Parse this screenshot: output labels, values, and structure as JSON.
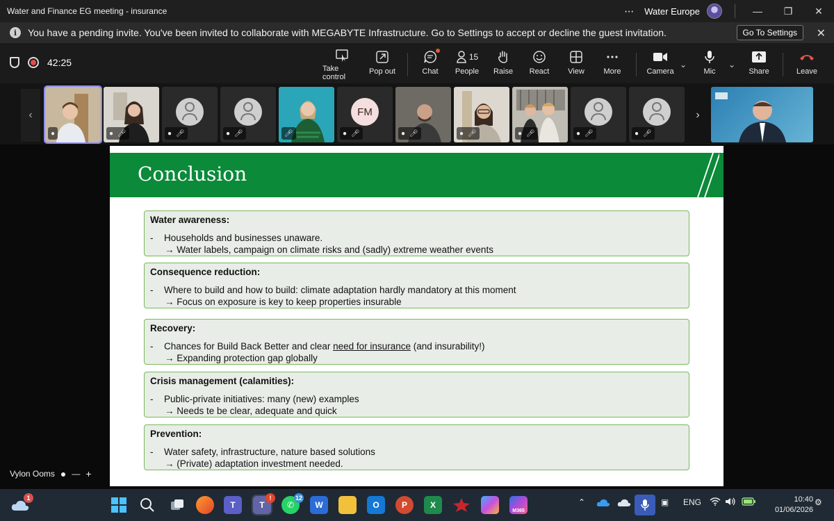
{
  "window": {
    "title": "Water and Finance EG meeting - insurance",
    "more_label": "⋯",
    "org_name": "Water Europe",
    "minimize": "—",
    "restore": "❐",
    "close": "✕"
  },
  "banner": {
    "message": "You have a pending invite. You've been invited to collaborate with MEGABYTE Infrastructure. Go to Settings to accept or decline the guest invitation.",
    "button": "Go To Settings",
    "close": "✕"
  },
  "meeting": {
    "timer": "42:25",
    "controls": {
      "take_control": "Take control",
      "pop_out": "Pop out",
      "chat": "Chat",
      "people": "People",
      "people_count": "15",
      "raise": "Raise",
      "react": "React",
      "view": "View",
      "more": "More",
      "camera": "Camera",
      "mic": "Mic",
      "share": "Share",
      "leave": "Leave"
    }
  },
  "gallery": {
    "initials_tile": "FM"
  },
  "slide": {
    "title": "Conclusion",
    "sections": [
      {
        "heading": "Water awareness:",
        "line1": "Households and businesses unaware.",
        "line2": "→ Water labels, campaign on climate risks and (sadly) extreme weather events"
      },
      {
        "heading": "Consequence reduction:",
        "line1": "Where to build and how to build: climate adaptation hardly mandatory at this moment",
        "line2": "→ Focus on exposure is key to keep properties insurable"
      },
      {
        "heading": "Recovery:",
        "line1_pre": "Chances for Build Back Better and clear ",
        "line1_underlined": "need for insurance",
        "line1_post": " (and insurability!)",
        "line2": "→ Expanding protection gap globally"
      },
      {
        "heading": "Crisis management (calamities):",
        "line1": "Public-private initiatives: many (new) examples",
        "line2": "→ Needs te be clear, adequate and quick"
      },
      {
        "heading": "Prevention:",
        "line1": "Water safety, infrastructure, nature based solutions",
        "line2": "→ (Private) adaptation investment needed."
      }
    ],
    "dash": "-"
  },
  "presenter": {
    "name": "Vylon Ooms",
    "minus": "—",
    "plus": "+"
  },
  "taskbar": {
    "weather_badge": "1",
    "whatsapp_badge": "12",
    "teams_alert": "!",
    "m365_label": "M365",
    "language": "ENG",
    "time": "10:40",
    "date": "01/06/2026"
  },
  "colors": {
    "slide_green": "#0b8a3a",
    "box_border": "#78b95a",
    "box_fill": "#e8ede7",
    "active_tile": "#8e8cf2",
    "leave_red": "#e0554a"
  }
}
